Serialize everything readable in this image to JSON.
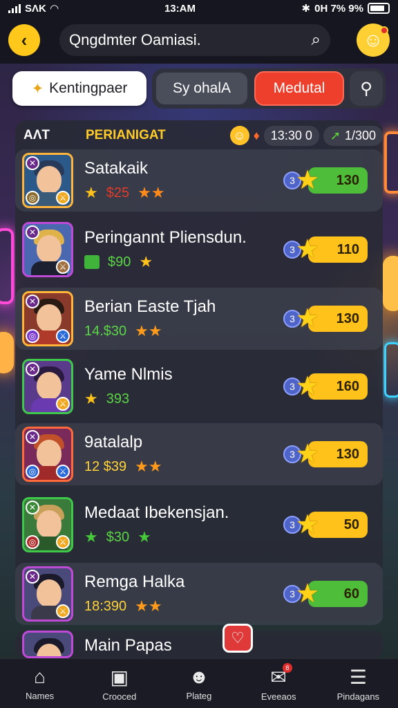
{
  "status": {
    "carrier": "SΛK",
    "time": "13:AM",
    "right_text": "0H 7% 9%"
  },
  "header": {
    "search_text": "Qngdmter Oamiasi."
  },
  "tabs": [
    {
      "label": "Kentingpaer"
    },
    {
      "label": "Sy ohalA"
    },
    {
      "label": "Medutal"
    }
  ],
  "panel": {
    "left_label": "AΛT",
    "title": "PERIANIGAT",
    "coins_a": "13:30 0",
    "coins_b": "1/300"
  },
  "rows": [
    {
      "name": "Satakaik",
      "stat": "$25",
      "level": "3",
      "score": "130"
    },
    {
      "name": "Peringannt Pliensdun.",
      "stat": "$90",
      "level": "3",
      "score": "110"
    },
    {
      "name": "Berian Easte Tjah",
      "stat": "14.$30",
      "level": "3",
      "score": "130"
    },
    {
      "name": "Yame Nlmis",
      "stat": "393",
      "level": "3",
      "score": "160"
    },
    {
      "name": "9atalalp",
      "stat": "12 $39",
      "level": "3",
      "score": "130"
    },
    {
      "name": "Medaat Ibekensjan.",
      "stat": "$30",
      "level": "3",
      "score": "50"
    },
    {
      "name": "Remga Halka",
      "stat": "18:390",
      "level": "3",
      "score": "60"
    },
    {
      "name": "Main Papas"
    }
  ],
  "nav": [
    {
      "label": "Names",
      "icon": "home-icon"
    },
    {
      "label": "Crooced",
      "icon": "square-icon"
    },
    {
      "label": "Plateg",
      "icon": "ninja-icon"
    },
    {
      "label": "Eveeaos",
      "icon": "chat-icon",
      "badge": "8"
    },
    {
      "label": "Pindagans",
      "icon": "menu-icon"
    }
  ],
  "colors": {
    "accent": "#ffc81a",
    "tab_red": "#ee3e2c",
    "panel": "#282a34"
  }
}
